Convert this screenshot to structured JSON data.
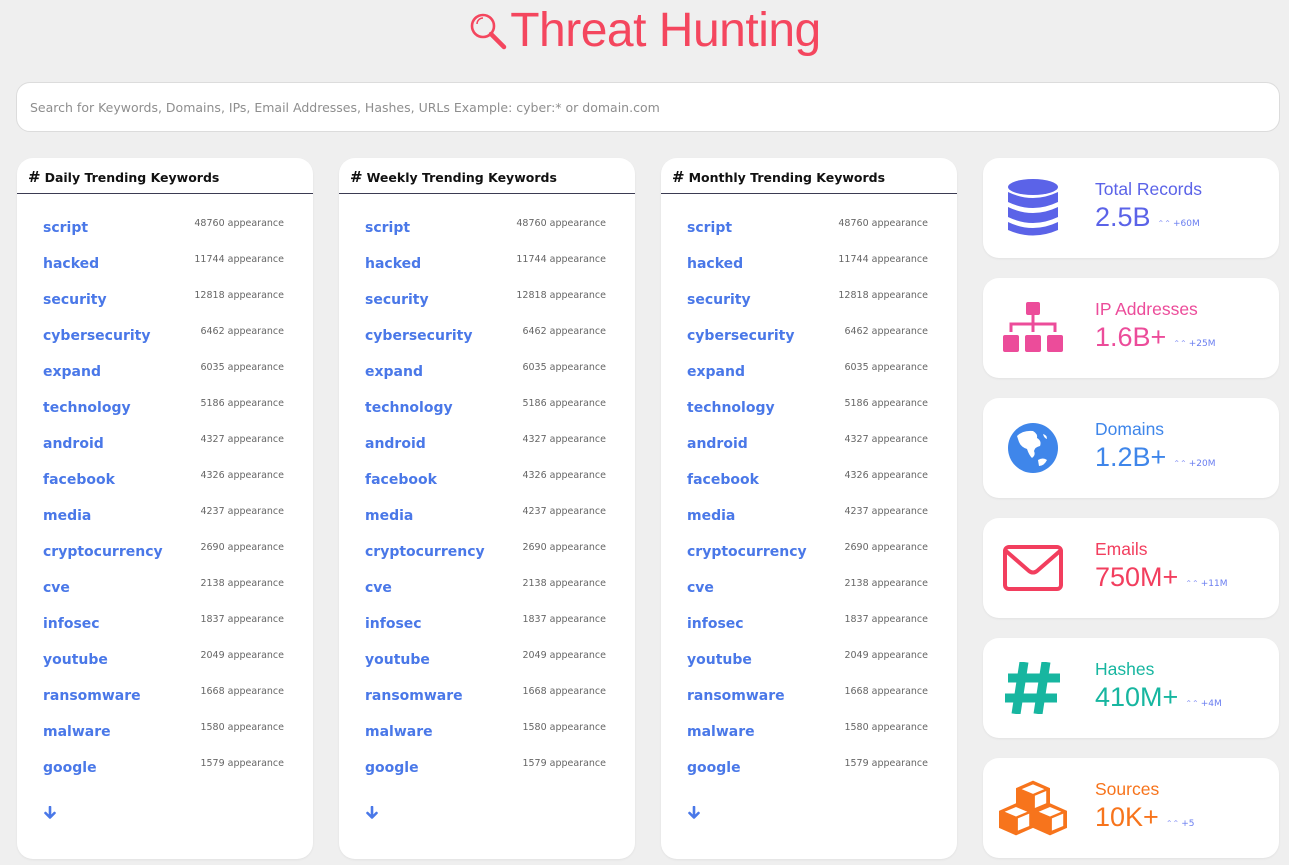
{
  "header": {
    "title": "Threat Hunting",
    "icon": "magnifier-icon",
    "color": "#f4465e"
  },
  "search": {
    "value": "",
    "placeholder": "Search for Keywords, Domains, IPs, Email Addresses, Hashes, URLs Example: cyber:* or domain.com"
  },
  "keyword_cards": [
    {
      "title": "Daily Trending Keywords",
      "hash_icon": "#",
      "items": [
        {
          "keyword": "script",
          "count": "48760 appearance"
        },
        {
          "keyword": "hacked",
          "count": "11744 appearance"
        },
        {
          "keyword": "security",
          "count": "12818 appearance"
        },
        {
          "keyword": "cybersecurity",
          "count": "6462 appearance"
        },
        {
          "keyword": "expand",
          "count": "6035 appearance"
        },
        {
          "keyword": "technology",
          "count": "5186 appearance"
        },
        {
          "keyword": "android",
          "count": "4327 appearance"
        },
        {
          "keyword": "facebook",
          "count": "4326 appearance"
        },
        {
          "keyword": "media",
          "count": "4237 appearance"
        },
        {
          "keyword": "cryptocurrency",
          "count": "2690 appearance"
        },
        {
          "keyword": "cve",
          "count": "2138 appearance"
        },
        {
          "keyword": "infosec",
          "count": "1837 appearance"
        },
        {
          "keyword": "youtube",
          "count": "2049 appearance"
        },
        {
          "keyword": "ransomware",
          "count": "1668 appearance"
        },
        {
          "keyword": "malware",
          "count": "1580 appearance"
        },
        {
          "keyword": "google",
          "count": "1579 appearance"
        }
      ]
    },
    {
      "title": "Weekly Trending Keywords",
      "hash_icon": "#",
      "items": [
        {
          "keyword": "script",
          "count": "48760 appearance"
        },
        {
          "keyword": "hacked",
          "count": "11744 appearance"
        },
        {
          "keyword": "security",
          "count": "12818 appearance"
        },
        {
          "keyword": "cybersecurity",
          "count": "6462 appearance"
        },
        {
          "keyword": "expand",
          "count": "6035 appearance"
        },
        {
          "keyword": "technology",
          "count": "5186 appearance"
        },
        {
          "keyword": "android",
          "count": "4327 appearance"
        },
        {
          "keyword": "facebook",
          "count": "4326 appearance"
        },
        {
          "keyword": "media",
          "count": "4237 appearance"
        },
        {
          "keyword": "cryptocurrency",
          "count": "2690 appearance"
        },
        {
          "keyword": "cve",
          "count": "2138 appearance"
        },
        {
          "keyword": "infosec",
          "count": "1837 appearance"
        },
        {
          "keyword": "youtube",
          "count": "2049 appearance"
        },
        {
          "keyword": "ransomware",
          "count": "1668 appearance"
        },
        {
          "keyword": "malware",
          "count": "1580 appearance"
        },
        {
          "keyword": "google",
          "count": "1579 appearance"
        }
      ]
    },
    {
      "title": "Monthly Trending Keywords",
      "hash_icon": "#",
      "items": [
        {
          "keyword": "script",
          "count": "48760 appearance"
        },
        {
          "keyword": "hacked",
          "count": "11744 appearance"
        },
        {
          "keyword": "security",
          "count": "12818 appearance"
        },
        {
          "keyword": "cybersecurity",
          "count": "6462 appearance"
        },
        {
          "keyword": "expand",
          "count": "6035 appearance"
        },
        {
          "keyword": "technology",
          "count": "5186 appearance"
        },
        {
          "keyword": "android",
          "count": "4327 appearance"
        },
        {
          "keyword": "facebook",
          "count": "4326 appearance"
        },
        {
          "keyword": "media",
          "count": "4237 appearance"
        },
        {
          "keyword": "cryptocurrency",
          "count": "2690 appearance"
        },
        {
          "keyword": "cve",
          "count": "2138 appearance"
        },
        {
          "keyword": "infosec",
          "count": "1837 appearance"
        },
        {
          "keyword": "youtube",
          "count": "2049 appearance"
        },
        {
          "keyword": "ransomware",
          "count": "1668 appearance"
        },
        {
          "keyword": "malware",
          "count": "1580 appearance"
        },
        {
          "keyword": "google",
          "count": "1579 appearance"
        }
      ]
    }
  ],
  "stats": [
    {
      "label": "Total Records",
      "value": "2.5B",
      "delta": "+60M",
      "icon": "database-icon",
      "color": "#5b63e8"
    },
    {
      "label": "IP Addresses",
      "value": "1.6B+",
      "delta": "+25M",
      "icon": "network-sitemap-icon",
      "color": "#ec4c9a"
    },
    {
      "label": "Domains",
      "value": "1.2B+",
      "delta": "+20M",
      "icon": "globe-icon",
      "color": "#3f86ea"
    },
    {
      "label": "Emails",
      "value": "750M+",
      "delta": "+11M",
      "icon": "envelope-icon",
      "color": "#f23e5e"
    },
    {
      "label": "Hashes",
      "value": "410M+",
      "delta": "+4M",
      "icon": "hashtag-icon",
      "color": "#17b6a0"
    },
    {
      "label": "Sources",
      "value": "10K+",
      "delta": "+5",
      "icon": "cubes-icon",
      "color": "#f7741c"
    }
  ],
  "delta_arrow": "»"
}
